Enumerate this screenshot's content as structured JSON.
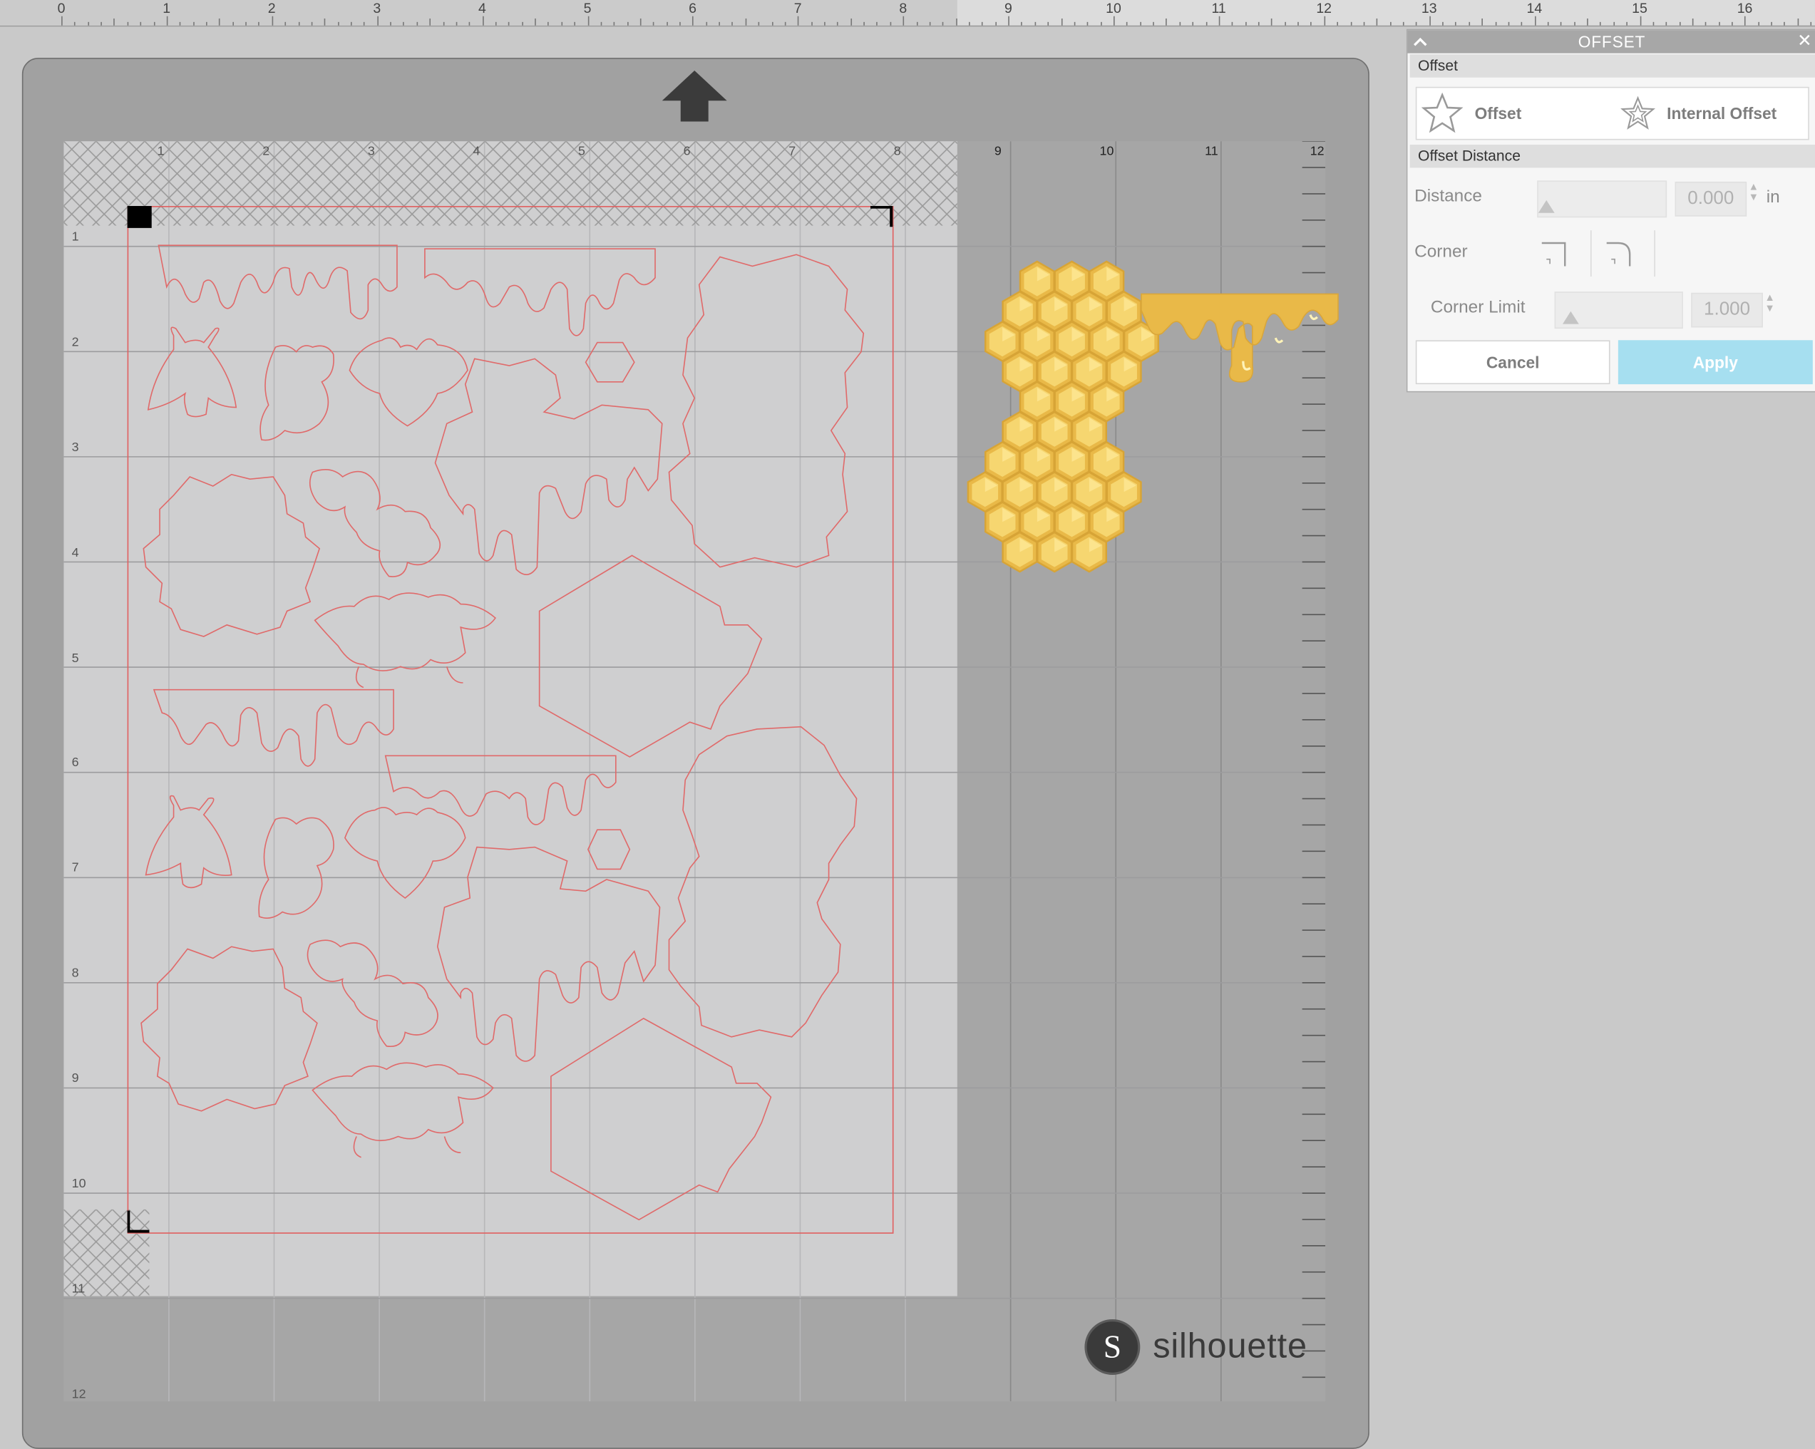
{
  "top_ruler": {
    "numbers": [
      "0",
      "1",
      "2",
      "3",
      "4",
      "5",
      "6",
      "7",
      "8",
      "9",
      "10",
      "11",
      "12",
      "13",
      "14",
      "15",
      "16"
    ]
  },
  "mat": {
    "top_numbers": [
      "1",
      "2",
      "3",
      "4",
      "5",
      "6",
      "7",
      "8",
      "9",
      "10",
      "11",
      "12"
    ],
    "left_numbers": [
      "1",
      "2",
      "3",
      "4",
      "5",
      "6",
      "7",
      "8",
      "9",
      "10",
      "11",
      "12"
    ],
    "brand_text": "silhouette",
    "brand_logo_letter": "S",
    "colors": {
      "mat": "#a6a6a6",
      "paper": "#cfcfd0",
      "cut_line": "#e06060",
      "honey": "#e9b948",
      "honey_light": "#f6d670"
    }
  },
  "offset_panel": {
    "title": "OFFSET",
    "collapse_icon": "chevron-up-icon",
    "close_icon": "close-icon",
    "section_offset": "Offset",
    "mode_offset_label": "Offset",
    "mode_internal_label": "Internal Offset",
    "section_distance": "Offset Distance",
    "distance_label": "Distance",
    "distance_value": "0.000",
    "distance_unit": "in",
    "corner_label": "Corner",
    "corner_limit_label": "Corner Limit",
    "corner_limit_value": "1.000",
    "cancel_label": "Cancel",
    "apply_label": "Apply",
    "apply_color": "#a6dff0"
  }
}
